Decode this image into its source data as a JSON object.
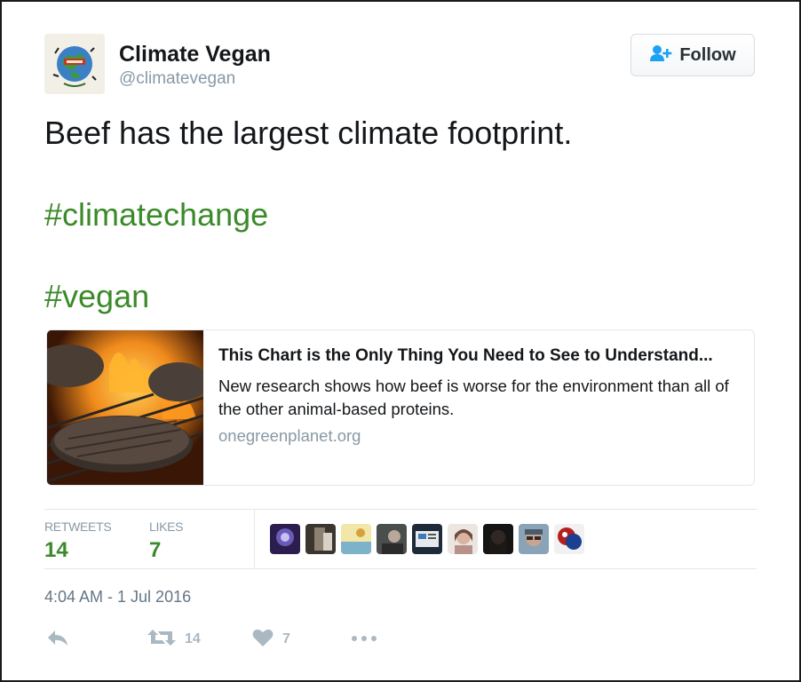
{
  "header": {
    "name": "Climate Vegan",
    "handle": "@climatevegan",
    "follow_label": "Follow"
  },
  "tweet": {
    "text": "Beef has the largest climate footprint.",
    "hashtags": [
      "#climatechange",
      "#vegan"
    ]
  },
  "card": {
    "title": "This Chart is the Only Thing You Need to See to Understand...",
    "description": "New research shows how beef is worse for the environment than all of the other animal-based proteins.",
    "domain": "onegreenplanet.org"
  },
  "stats": {
    "retweets_label": "RETWEETS",
    "retweets": "14",
    "likes_label": "LIKES",
    "likes": "7"
  },
  "liker_avatars": [
    "avatar-1",
    "avatar-2",
    "avatar-3",
    "avatar-4",
    "avatar-5",
    "avatar-6",
    "avatar-7",
    "avatar-8",
    "avatar-9"
  ],
  "timestamp": "4:04 AM - 1 Jul 2016",
  "actions": {
    "retweet_count": "14",
    "like_count": "7"
  },
  "colors": {
    "accent": "#3b8a2a",
    "muted": "#8899a6",
    "border": "#e1e8ed"
  }
}
